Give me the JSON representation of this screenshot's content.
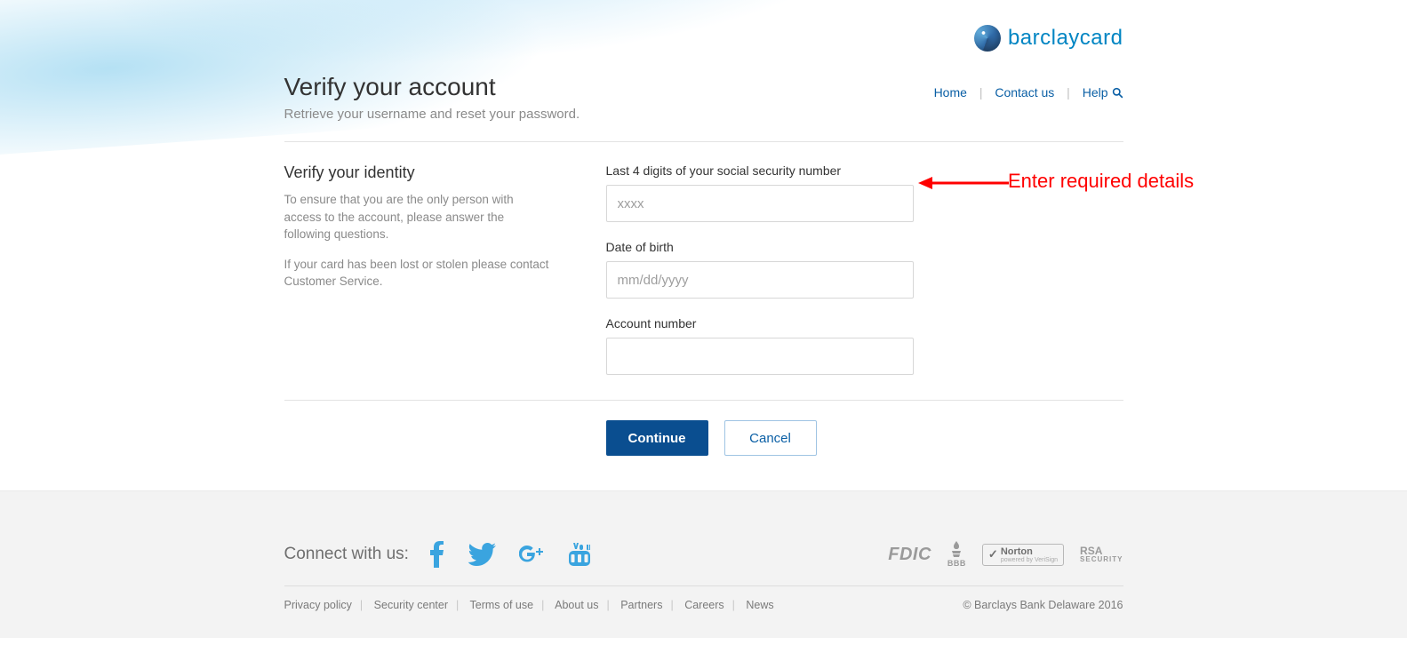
{
  "brand": {
    "name": "barclaycard"
  },
  "nav": {
    "home": "Home",
    "contact": "Contact us",
    "help": "Help"
  },
  "header": {
    "title": "Verify your account",
    "subtitle": "Retrieve your username and reset your password."
  },
  "identity": {
    "heading": "Verify your identity",
    "para1": "To ensure that you are the only person with access to the account, please answer the following questions.",
    "para2": "If your card has been lost or stolen please contact Customer Service."
  },
  "form": {
    "ssn": {
      "label": "Last 4 digits of your social security number",
      "placeholder": "xxxx",
      "value": ""
    },
    "dob": {
      "label": "Date of birth",
      "placeholder": "mm/dd/yyyy",
      "value": ""
    },
    "acct": {
      "label": "Account number",
      "placeholder": "",
      "value": ""
    }
  },
  "buttons": {
    "continue": "Continue",
    "cancel": "Cancel"
  },
  "annotation": {
    "text": "Enter required details"
  },
  "footer": {
    "connect_label": "Connect with us:",
    "badges": {
      "fdic": "FDIC",
      "bbb": "BBB",
      "norton": "Norton",
      "rsa": "RSA",
      "rsa_sub": "SECURITY"
    },
    "links": {
      "privacy": "Privacy policy",
      "security": "Security center",
      "terms": "Terms of use",
      "about": "About us",
      "partners": "Partners",
      "careers": "Careers",
      "news": "News"
    },
    "copyright": "© Barclays Bank Delaware 2016"
  }
}
